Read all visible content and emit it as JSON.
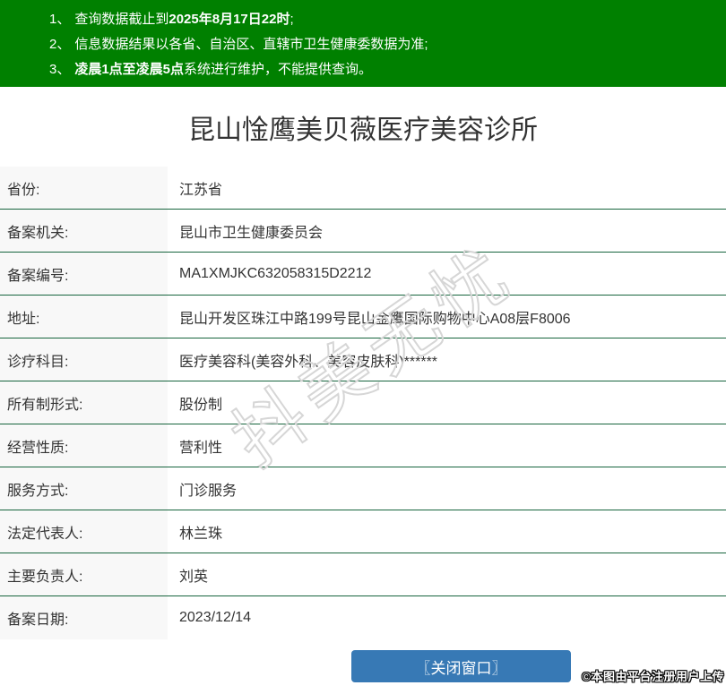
{
  "notice": {
    "items": [
      {
        "num": "1、",
        "pre": "查询数据截止到",
        "bold": "2025年8月17日22时",
        "post": ";"
      },
      {
        "num": "2、",
        "pre": "信息数据结果以各省、自治区、直辖市卫生健康委数据为准;",
        "bold": "",
        "post": ""
      },
      {
        "num": "3、",
        "pre": "",
        "bold": "凌晨1点至凌晨5点",
        "post": "系统进行维护，不能提供查询。"
      }
    ]
  },
  "title": "昆山惍鹰美贝薇医疗美容诊所",
  "table": {
    "rows": [
      {
        "label": "省份:",
        "value": "江苏省"
      },
      {
        "label": "备案机关:",
        "value": "昆山市卫生健康委员会"
      },
      {
        "label": "备案编号:",
        "value": "MA1XMJKC632058315D2212"
      },
      {
        "label": "地址:",
        "value": "昆山开发区珠江中路199号昆山金鹰国际购物中心A08层F8006"
      },
      {
        "label": "诊疗科目:",
        "value": "医疗美容科(美容外科、美容皮肤科)******"
      },
      {
        "label": "所有制形式:",
        "value": "股份制"
      },
      {
        "label": "经营性质:",
        "value": "营利性"
      },
      {
        "label": "服务方式:",
        "value": "门诊服务"
      },
      {
        "label": "法定代表人:",
        "value": "林兰珠"
      },
      {
        "label": "主要负责人:",
        "value": "刘英"
      },
      {
        "label": "备案日期:",
        "value": "2023/12/14"
      }
    ]
  },
  "watermark": "抖美无忧",
  "footer": {
    "close_button": "〖关闭窗口〗",
    "disclaimer": "©本图由平台注册用户上传"
  },
  "colors": {
    "banner_green": "#008000",
    "row_divider_green": "#17653e",
    "button_blue": "#3779b5",
    "label_bg": "#f8f8f8",
    "text": "#333333"
  }
}
